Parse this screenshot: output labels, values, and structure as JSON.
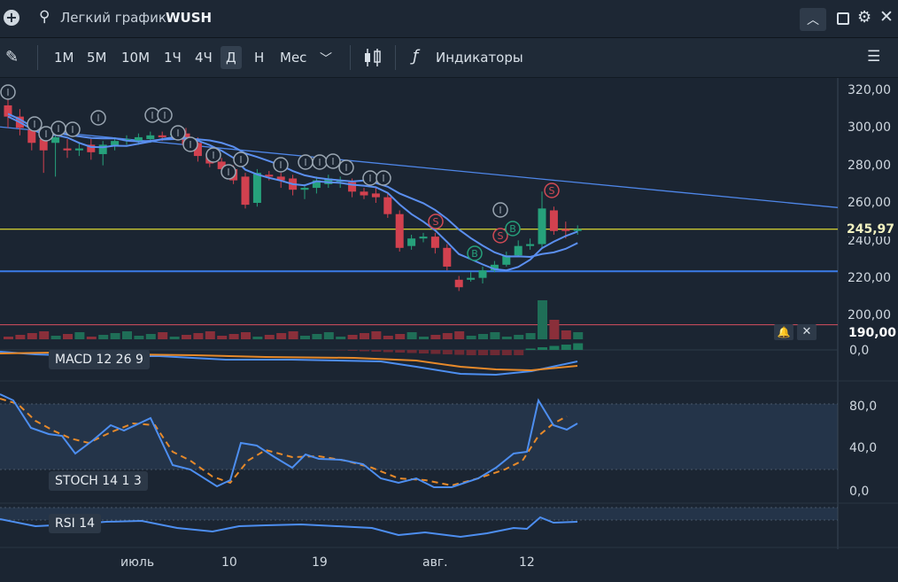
{
  "window": {
    "title_prefix": "Легкий график",
    "ticker": "WUSH"
  },
  "toolbar": {
    "periods": [
      "1М",
      "5М",
      "10М",
      "1Ч",
      "4Ч",
      "Д",
      "Н",
      "Мес"
    ],
    "active_period": "Д",
    "indicators_label": "Индикаторы"
  },
  "panels": {
    "macd_label": "MACD 12 26 9",
    "stoch_label": "STOCH 14 1 3",
    "rsi_label": "RSI 14"
  },
  "price_axis": {
    "ticks": [
      "320,00",
      "300,00",
      "280,00",
      "260,00",
      "240,00",
      "220,00",
      "200,00"
    ],
    "current_price": "245,97",
    "alert_level": "190,00"
  },
  "macd_axis": {
    "ticks": [
      "0,0"
    ]
  },
  "stoch_axis": {
    "ticks": [
      "80,0",
      "40,0",
      "0,0"
    ]
  },
  "time_axis": {
    "labels": [
      "июль",
      "10",
      "19",
      "авг.",
      "12"
    ]
  },
  "markers": {
    "info": "I",
    "sell": "S",
    "buy": "B"
  },
  "colors": {
    "background": "#1b2532",
    "up_candle": "#26a17b",
    "down_candle": "#d2414f",
    "ma_line": "#5b8ff0",
    "trend_line": "#4e86e8",
    "current_price_line": "#c8c632",
    "support_line": "#3b7ce8",
    "alert_line": "#c04a5a",
    "macd_line": "#4d8ef0",
    "macd_signal": "#e6892a",
    "stoch_k": "#4d8ef0",
    "stoch_d": "#e6892a"
  },
  "chart_data": {
    "type": "candlestick",
    "title": "",
    "price_range": [
      190,
      325
    ],
    "candles": [
      {
        "o": 312,
        "c": 306,
        "h": 318,
        "l": 300
      },
      {
        "o": 306,
        "c": 300,
        "h": 310,
        "l": 296
      },
      {
        "o": 299,
        "c": 292,
        "h": 302,
        "l": 288
      },
      {
        "o": 294,
        "c": 288,
        "h": 297,
        "l": 276
      },
      {
        "o": 292,
        "c": 295,
        "h": 298,
        "l": 274
      },
      {
        "o": 289,
        "c": 288,
        "h": 294,
        "l": 284
      },
      {
        "o": 288,
        "c": 289,
        "h": 292,
        "l": 285
      },
      {
        "o": 291,
        "c": 287,
        "h": 294,
        "l": 283
      },
      {
        "o": 286,
        "c": 291,
        "h": 293,
        "l": 280
      },
      {
        "o": 290,
        "c": 293,
        "h": 295,
        "l": 288
      },
      {
        "o": 293,
        "c": 294,
        "h": 296,
        "l": 291
      },
      {
        "o": 293,
        "c": 295,
        "h": 297,
        "l": 291
      },
      {
        "o": 294,
        "c": 296,
        "h": 298,
        "l": 292
      },
      {
        "o": 296,
        "c": 295,
        "h": 298,
        "l": 293
      },
      {
        "o": 296,
        "c": 297,
        "h": 300,
        "l": 294
      },
      {
        "o": 297,
        "c": 291,
        "h": 300,
        "l": 288
      },
      {
        "o": 292,
        "c": 285,
        "h": 295,
        "l": 282
      },
      {
        "o": 286,
        "c": 281,
        "h": 289,
        "l": 279
      },
      {
        "o": 282,
        "c": 278,
        "h": 284,
        "l": 275
      },
      {
        "o": 278,
        "c": 272,
        "h": 280,
        "l": 270
      },
      {
        "o": 274,
        "c": 259,
        "h": 276,
        "l": 257
      },
      {
        "o": 260,
        "c": 276,
        "h": 278,
        "l": 258
      },
      {
        "o": 275,
        "c": 274,
        "h": 277,
        "l": 272
      },
      {
        "o": 274,
        "c": 272,
        "h": 276,
        "l": 268
      },
      {
        "o": 273,
        "c": 267,
        "h": 275,
        "l": 264
      },
      {
        "o": 267,
        "c": 268,
        "h": 270,
        "l": 262
      },
      {
        "o": 268,
        "c": 272,
        "h": 274,
        "l": 265
      },
      {
        "o": 270,
        "c": 273,
        "h": 275,
        "l": 268
      },
      {
        "o": 272,
        "c": 272,
        "h": 274,
        "l": 268
      },
      {
        "o": 271,
        "c": 266,
        "h": 273,
        "l": 263
      },
      {
        "o": 266,
        "c": 264,
        "h": 268,
        "l": 262
      },
      {
        "o": 265,
        "c": 263,
        "h": 268,
        "l": 260
      },
      {
        "o": 263,
        "c": 254,
        "h": 265,
        "l": 252
      },
      {
        "o": 254,
        "c": 236,
        "h": 256,
        "l": 234
      },
      {
        "o": 237,
        "c": 241,
        "h": 243,
        "l": 235
      },
      {
        "o": 241,
        "c": 242,
        "h": 244,
        "l": 239
      },
      {
        "o": 242,
        "c": 236,
        "h": 244,
        "l": 233
      },
      {
        "o": 236,
        "c": 226,
        "h": 238,
        "l": 224
      },
      {
        "o": 219,
        "c": 215,
        "h": 221,
        "l": 213
      },
      {
        "o": 219,
        "c": 220,
        "h": 223,
        "l": 218
      },
      {
        "o": 220,
        "c": 224,
        "h": 226,
        "l": 217
      },
      {
        "o": 224,
        "c": 227,
        "h": 229,
        "l": 223
      },
      {
        "o": 227,
        "c": 232,
        "h": 234,
        "l": 226
      },
      {
        "o": 232,
        "c": 237,
        "h": 240,
        "l": 231
      },
      {
        "o": 237,
        "c": 238,
        "h": 241,
        "l": 235
      },
      {
        "o": 238,
        "c": 257,
        "h": 266,
        "l": 236
      },
      {
        "o": 256,
        "c": 245,
        "h": 258,
        "l": 243
      },
      {
        "o": 246,
        "c": 245,
        "h": 250,
        "l": 241
      },
      {
        "o": 245,
        "c": 246,
        "h": 248,
        "l": 243
      }
    ],
    "current_price": 245.97,
    "support_level": 223.5,
    "alert_level": 190.0
  }
}
